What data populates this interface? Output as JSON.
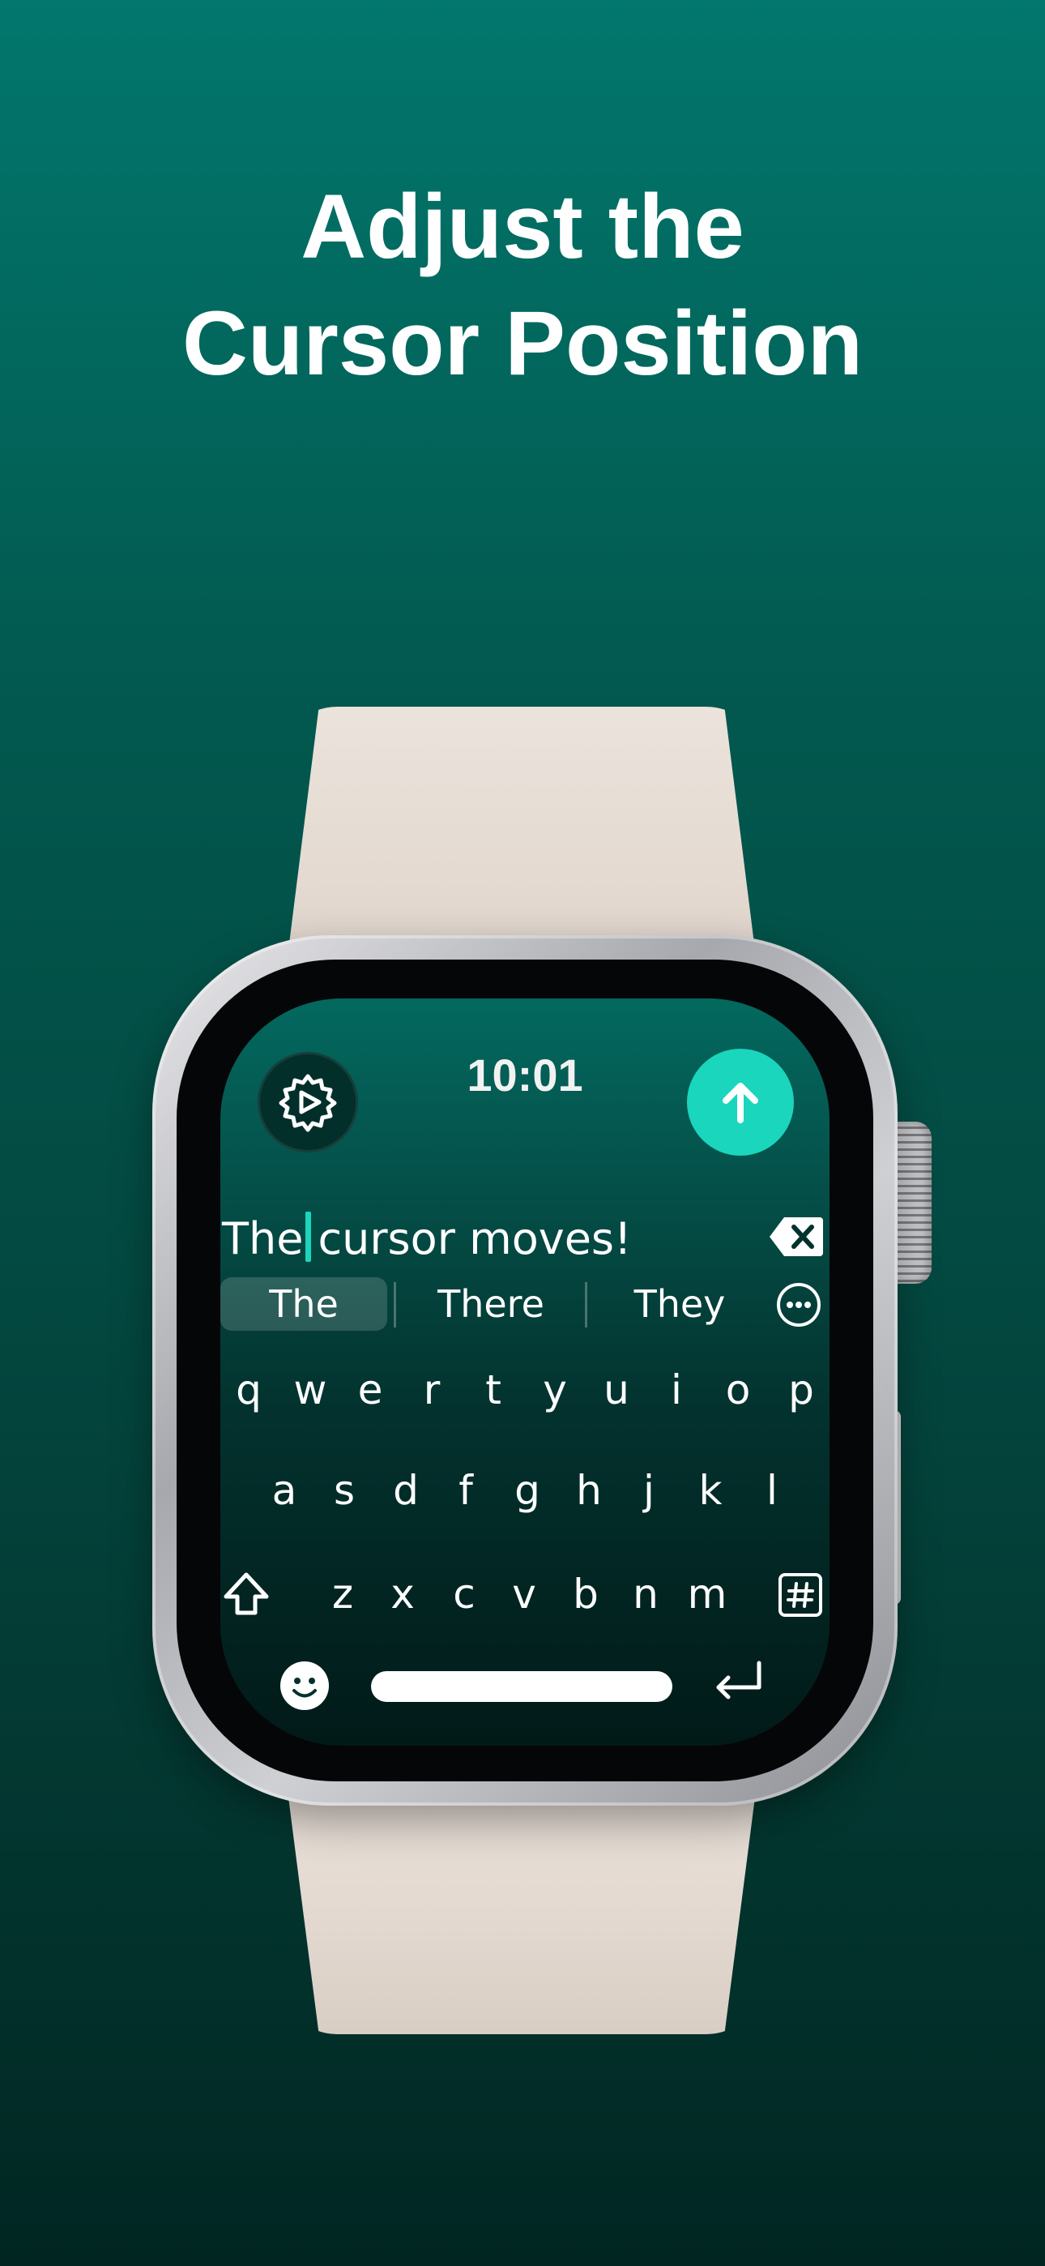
{
  "headline": {
    "line1": "Adjust the",
    "line2": "Cursor Position"
  },
  "colors": {
    "background_top": "#02776d",
    "background_bottom": "#012622",
    "accent": "#1ad6bd",
    "band": "#e6ddd4",
    "case": "#b8b9be"
  },
  "watch": {
    "time": "10:01",
    "icons": {
      "settings": "gear-icon",
      "send": "arrow-up-icon",
      "backspace": "backspace-icon",
      "more": "ellipsis-circle-icon",
      "shift": "shift-icon",
      "symbols": "hash-icon",
      "emoji": "emoji-icon",
      "return": "return-icon"
    },
    "text": {
      "before_cursor": "The",
      "after_cursor": "cursor moves!"
    },
    "suggestions": [
      "The",
      "There",
      "They"
    ],
    "keyboard": {
      "row1": [
        "q",
        "w",
        "e",
        "r",
        "t",
        "y",
        "u",
        "i",
        "o",
        "p"
      ],
      "row2": [
        "a",
        "s",
        "d",
        "f",
        "g",
        "h",
        "j",
        "k",
        "l"
      ],
      "row3": [
        "z",
        "x",
        "c",
        "v",
        "b",
        "n",
        "m"
      ]
    }
  }
}
